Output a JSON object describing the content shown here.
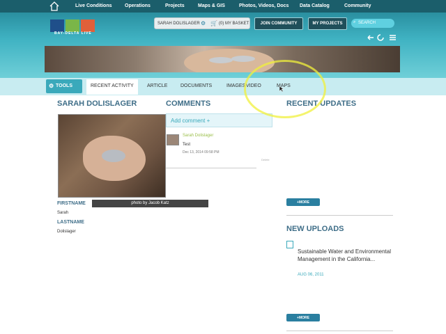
{
  "topnav": {
    "items": [
      "Live Conditions",
      "Operations",
      "Projects",
      "Maps & GIS",
      "Photos, Videos, Docs",
      "Data Catalog",
      "Community"
    ]
  },
  "logo": {
    "text": "BAY-DELTA LIVE"
  },
  "header": {
    "username": "SARAH DOLISLAGER",
    "basket": "(0) MY BASKET",
    "join": "JOIN COMMUNITY",
    "my_projects": "MY PROJECTS",
    "search_placeholder": "SEARCH"
  },
  "tabs": {
    "tools": "TOOLS",
    "items": [
      "RECENT ACTIVITY",
      "ARTICLE",
      "DOCUMENTS",
      "IMAGES",
      "VIDEO",
      "MAPS"
    ]
  },
  "profile": {
    "name": "SARAH DOLISLAGER",
    "photo_caption": "photo by Jacob Katz",
    "firstname_label": "FIRSTNAME",
    "firstname": "Sarah",
    "lastname_label": "LASTNAME",
    "lastname": "Dolislager"
  },
  "comments": {
    "heading": "COMMENTS",
    "add_label": "Add comment +",
    "items": [
      {
        "user": "Sarah Dolislager",
        "text": "Test",
        "date": "Dec 13, 2014 09:58 PM",
        "delete": "Delete"
      }
    ]
  },
  "recent_updates": {
    "heading": "RECENT UPDATES",
    "more": "+MORE"
  },
  "new_uploads": {
    "heading": "NEW UPLOADS",
    "items": [
      {
        "title": "Sustainable Water and Environmental Management in the California...",
        "date": "AUG 06, 2011"
      }
    ],
    "more": "+MORE"
  },
  "colors": {
    "nav_bg": "#1b5e6b",
    "accent": "#3aa9bb",
    "heading": "#3f6e88",
    "tabbar": "#c8ecf1"
  }
}
